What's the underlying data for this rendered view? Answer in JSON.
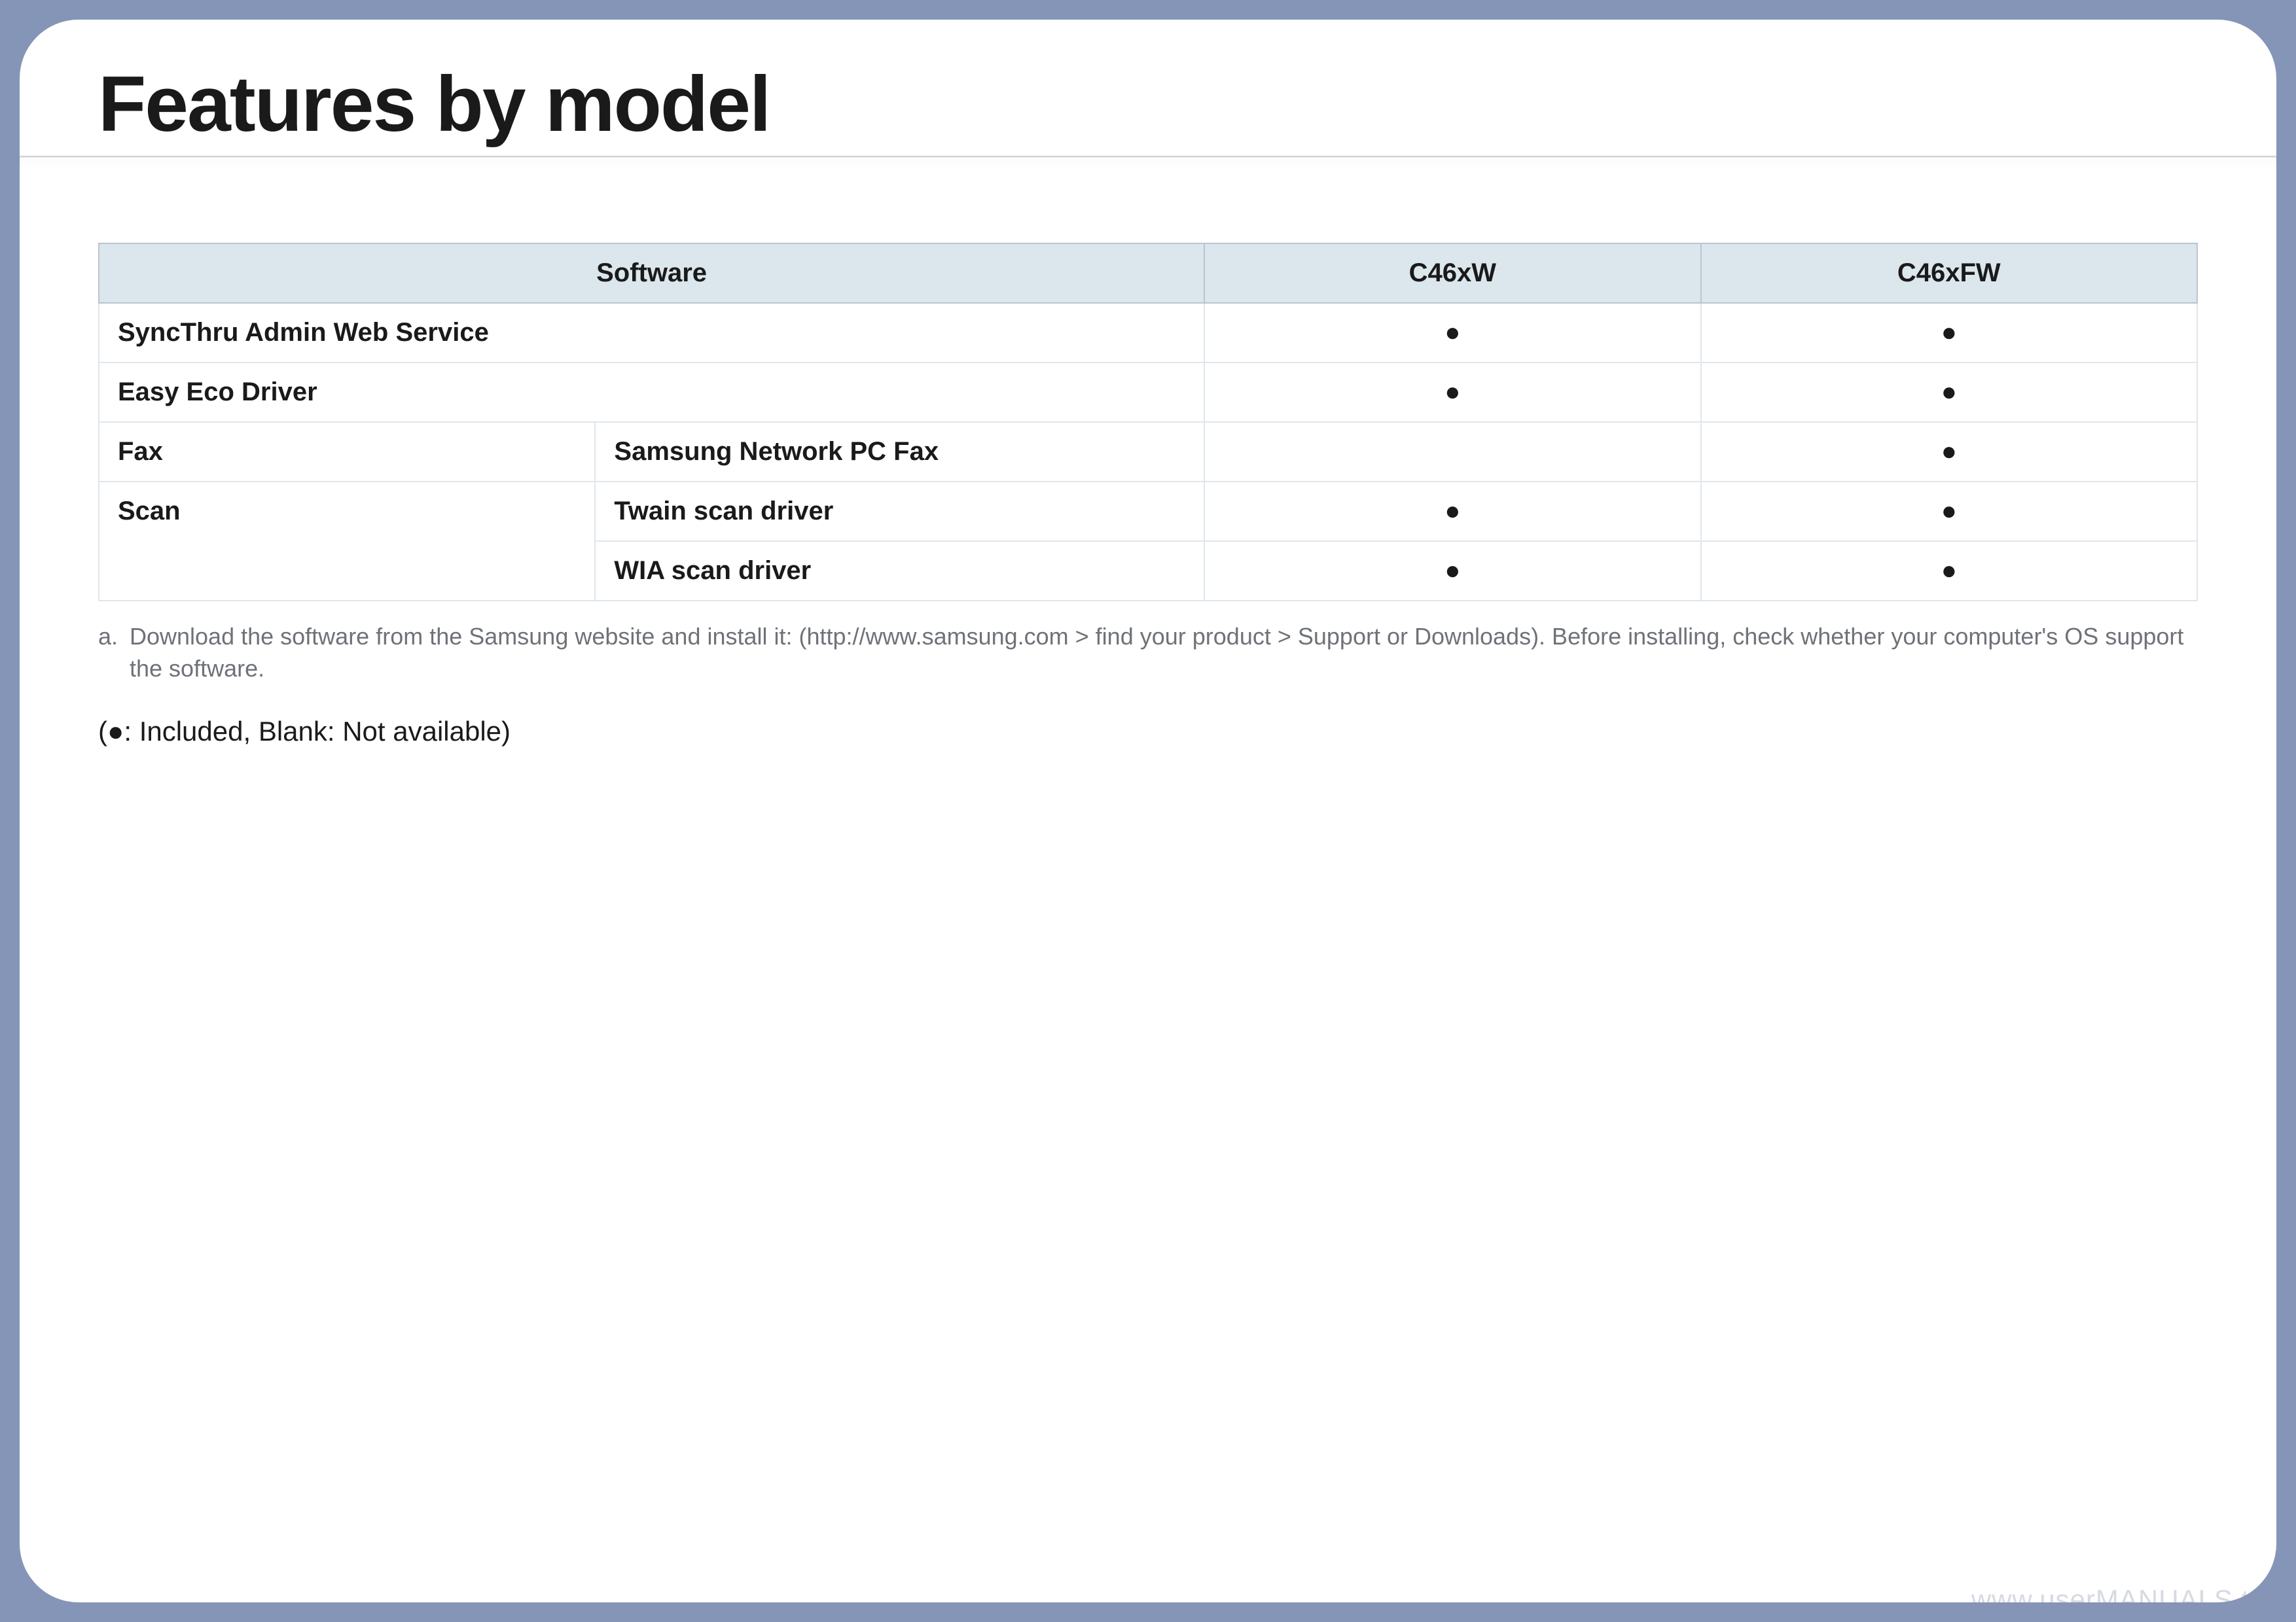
{
  "title": "Features by model",
  "chart_data": {
    "type": "table",
    "columns": [
      "Software",
      "C46xW",
      "C46xFW"
    ],
    "rows": [
      {
        "software": "SyncThru Admin Web Service",
        "sub": "",
        "C46xW": "●",
        "C46xFW": "●"
      },
      {
        "software": "Easy Eco Driver",
        "sub": "",
        "C46xW": "●",
        "C46xFW": "●"
      },
      {
        "software": "Fax",
        "sub": "Samsung Network PC Fax",
        "C46xW": "",
        "C46xFW": "●"
      },
      {
        "software": "Scan",
        "sub": "Twain scan driver",
        "C46xW": "●",
        "C46xFW": "●"
      },
      {
        "software": "",
        "sub": "WIA scan driver",
        "C46xW": "●",
        "C46xFW": "●"
      }
    ]
  },
  "table": {
    "headers": {
      "software": "Software",
      "model1": "C46xW",
      "model2": "C46xFW"
    },
    "rows": {
      "r1": {
        "main": "SyncThru Admin Web Service",
        "sub": "",
        "m1": "●",
        "m2": "●"
      },
      "r2": {
        "main": "Easy Eco Driver",
        "sub": "",
        "m1": "●",
        "m2": "●"
      },
      "r3": {
        "main": "Fax",
        "sub": "Samsung Network PC Fax",
        "m1": "",
        "m2": "●"
      },
      "r4": {
        "main": "Scan",
        "sub": "Twain scan driver",
        "m1": "●",
        "m2": "●"
      },
      "r5": {
        "main": "",
        "sub": "WIA scan driver",
        "m1": "●",
        "m2": "●"
      }
    }
  },
  "footnote": {
    "marker": "a.",
    "text": "Download the software from the Samsung website and install it: (http://www.samsung.com > find your product > Support or Downloads). Before installing, check whether your computer's OS support the software."
  },
  "legend": "(●: Included, Blank: Not available)",
  "watermark": "www.userMANUALS.tech"
}
